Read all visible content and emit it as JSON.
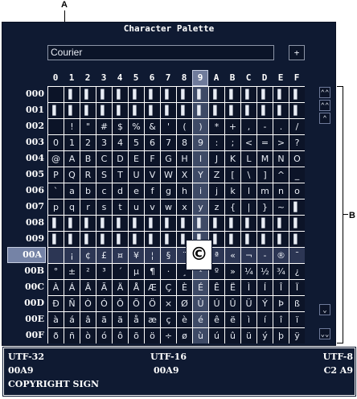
{
  "callouts": {
    "a": "A",
    "b": "B"
  },
  "title": "Character Palette",
  "font": {
    "selected": "Courier"
  },
  "add_button": "+",
  "columns": [
    "0",
    "1",
    "2",
    "3",
    "4",
    "5",
    "6",
    "7",
    "8",
    "9",
    "A",
    "B",
    "C",
    "D",
    "E",
    "F"
  ],
  "selected_column": 9,
  "rows": [
    "000",
    "001",
    "002",
    "003",
    "004",
    "005",
    "006",
    "007",
    "008",
    "009",
    "00A",
    "00B",
    "00C",
    "00D",
    "00E",
    "00F"
  ],
  "selected_row": 10,
  "grid": [
    [
      "",
      "▌",
      "▌",
      "▌",
      "▌",
      "▌",
      "▌",
      "▌",
      "▌",
      "▌",
      "▌",
      "▌",
      "▌",
      "▌",
      "▌",
      "▌"
    ],
    [
      "▌",
      "▌",
      "▌",
      "▌",
      "▌",
      "▌",
      "▌",
      "▌",
      "▌",
      "▌",
      "▌",
      "▌",
      "▌",
      "▌",
      "▌",
      "▌"
    ],
    [
      " ",
      "!",
      "\"",
      "#",
      "$",
      "%",
      "&",
      "'",
      "(",
      ")",
      "*",
      "+",
      ",",
      "-",
      ".",
      "/"
    ],
    [
      "0",
      "1",
      "2",
      "3",
      "4",
      "5",
      "6",
      "7",
      "8",
      "9",
      ":",
      ";",
      "<",
      "=",
      ">",
      "?"
    ],
    [
      "@",
      "A",
      "B",
      "C",
      "D",
      "E",
      "F",
      "G",
      "H",
      "I",
      "J",
      "K",
      "L",
      "M",
      "N",
      "O"
    ],
    [
      "P",
      "Q",
      "R",
      "S",
      "T",
      "U",
      "V",
      "W",
      "X",
      "Y",
      "Z",
      "[",
      "\\",
      "]",
      "^",
      "_"
    ],
    [
      "`",
      "a",
      "b",
      "c",
      "d",
      "e",
      "f",
      "g",
      "h",
      "i",
      "j",
      "k",
      "l",
      "m",
      "n",
      "o"
    ],
    [
      "p",
      "q",
      "r",
      "s",
      "t",
      "u",
      "v",
      "w",
      "x",
      "y",
      "z",
      "{",
      "|",
      "}",
      "~",
      "▌"
    ],
    [
      "▌",
      "▌",
      "▌",
      "▌",
      "▌",
      "▌",
      "▌",
      "▌",
      "▌",
      "▌",
      "▌",
      "▌",
      "▌",
      "▌",
      "▌",
      "▌"
    ],
    [
      "▌",
      "▌",
      "▌",
      "▌",
      "▌",
      "▌",
      "▌",
      "▌",
      "▌",
      "▌",
      "▌",
      "▌",
      "▌",
      "▌",
      "▌",
      "▌"
    ],
    [
      " ",
      "¡",
      "¢",
      "£",
      "¤",
      "¥",
      "¦",
      "§",
      "¨",
      "©",
      "ª",
      "«",
      "¬",
      "-",
      "®",
      "¯"
    ],
    [
      "°",
      "±",
      "²",
      "³",
      "´",
      "µ",
      "¶",
      "·",
      "¸",
      "¹",
      "º",
      "»",
      "¼",
      "½",
      "¾",
      "¿"
    ],
    [
      "À",
      "Á",
      "Â",
      "Ã",
      "Ä",
      "Å",
      "Æ",
      "Ç",
      "È",
      "É",
      "Ê",
      "Ë",
      "Ì",
      "Í",
      "Î",
      "Ï"
    ],
    [
      "Ð",
      "Ñ",
      "Ò",
      "Ó",
      "Ô",
      "Õ",
      "Ö",
      "×",
      "Ø",
      "Ù",
      "Ú",
      "Û",
      "Ü",
      "Ý",
      "Þ",
      "ß"
    ],
    [
      "à",
      "á",
      "â",
      "ã",
      "ä",
      "å",
      "æ",
      "ç",
      "è",
      "é",
      "ê",
      "ë",
      "ì",
      "í",
      "î",
      "ï"
    ],
    [
      "ð",
      "ñ",
      "ò",
      "ó",
      "ô",
      "õ",
      "ö",
      "÷",
      "ø",
      "ù",
      "ú",
      "û",
      "ü",
      "ý",
      "þ",
      "ÿ"
    ]
  ],
  "preview_char": "©",
  "scroll": {
    "top": "⌃⌃",
    "page_up": "⌃⌃",
    "up": "⌃",
    "down": "⌄",
    "bottom": "⌄⌄"
  },
  "icons": {
    "scroll_top": "double-chevron-up-icon",
    "page_up": "double-chevron-up-icon",
    "up": "chevron-up-icon",
    "down": "chevron-down-icon",
    "bottom": "double-chevron-down-icon"
  },
  "info": {
    "utf32_label": "UTF-32",
    "utf16_label": "UTF-16",
    "utf8_label": "UTF-8",
    "utf32_value": "00A9",
    "utf16_value": "00A9",
    "utf8_value": "C2 A9",
    "char_name": "COPYRIGHT SIGN"
  },
  "colors": {
    "background": "#0f1a32",
    "cell": "#0c1428",
    "selection": "#6f7b9b",
    "text": "#e8ecf4"
  }
}
